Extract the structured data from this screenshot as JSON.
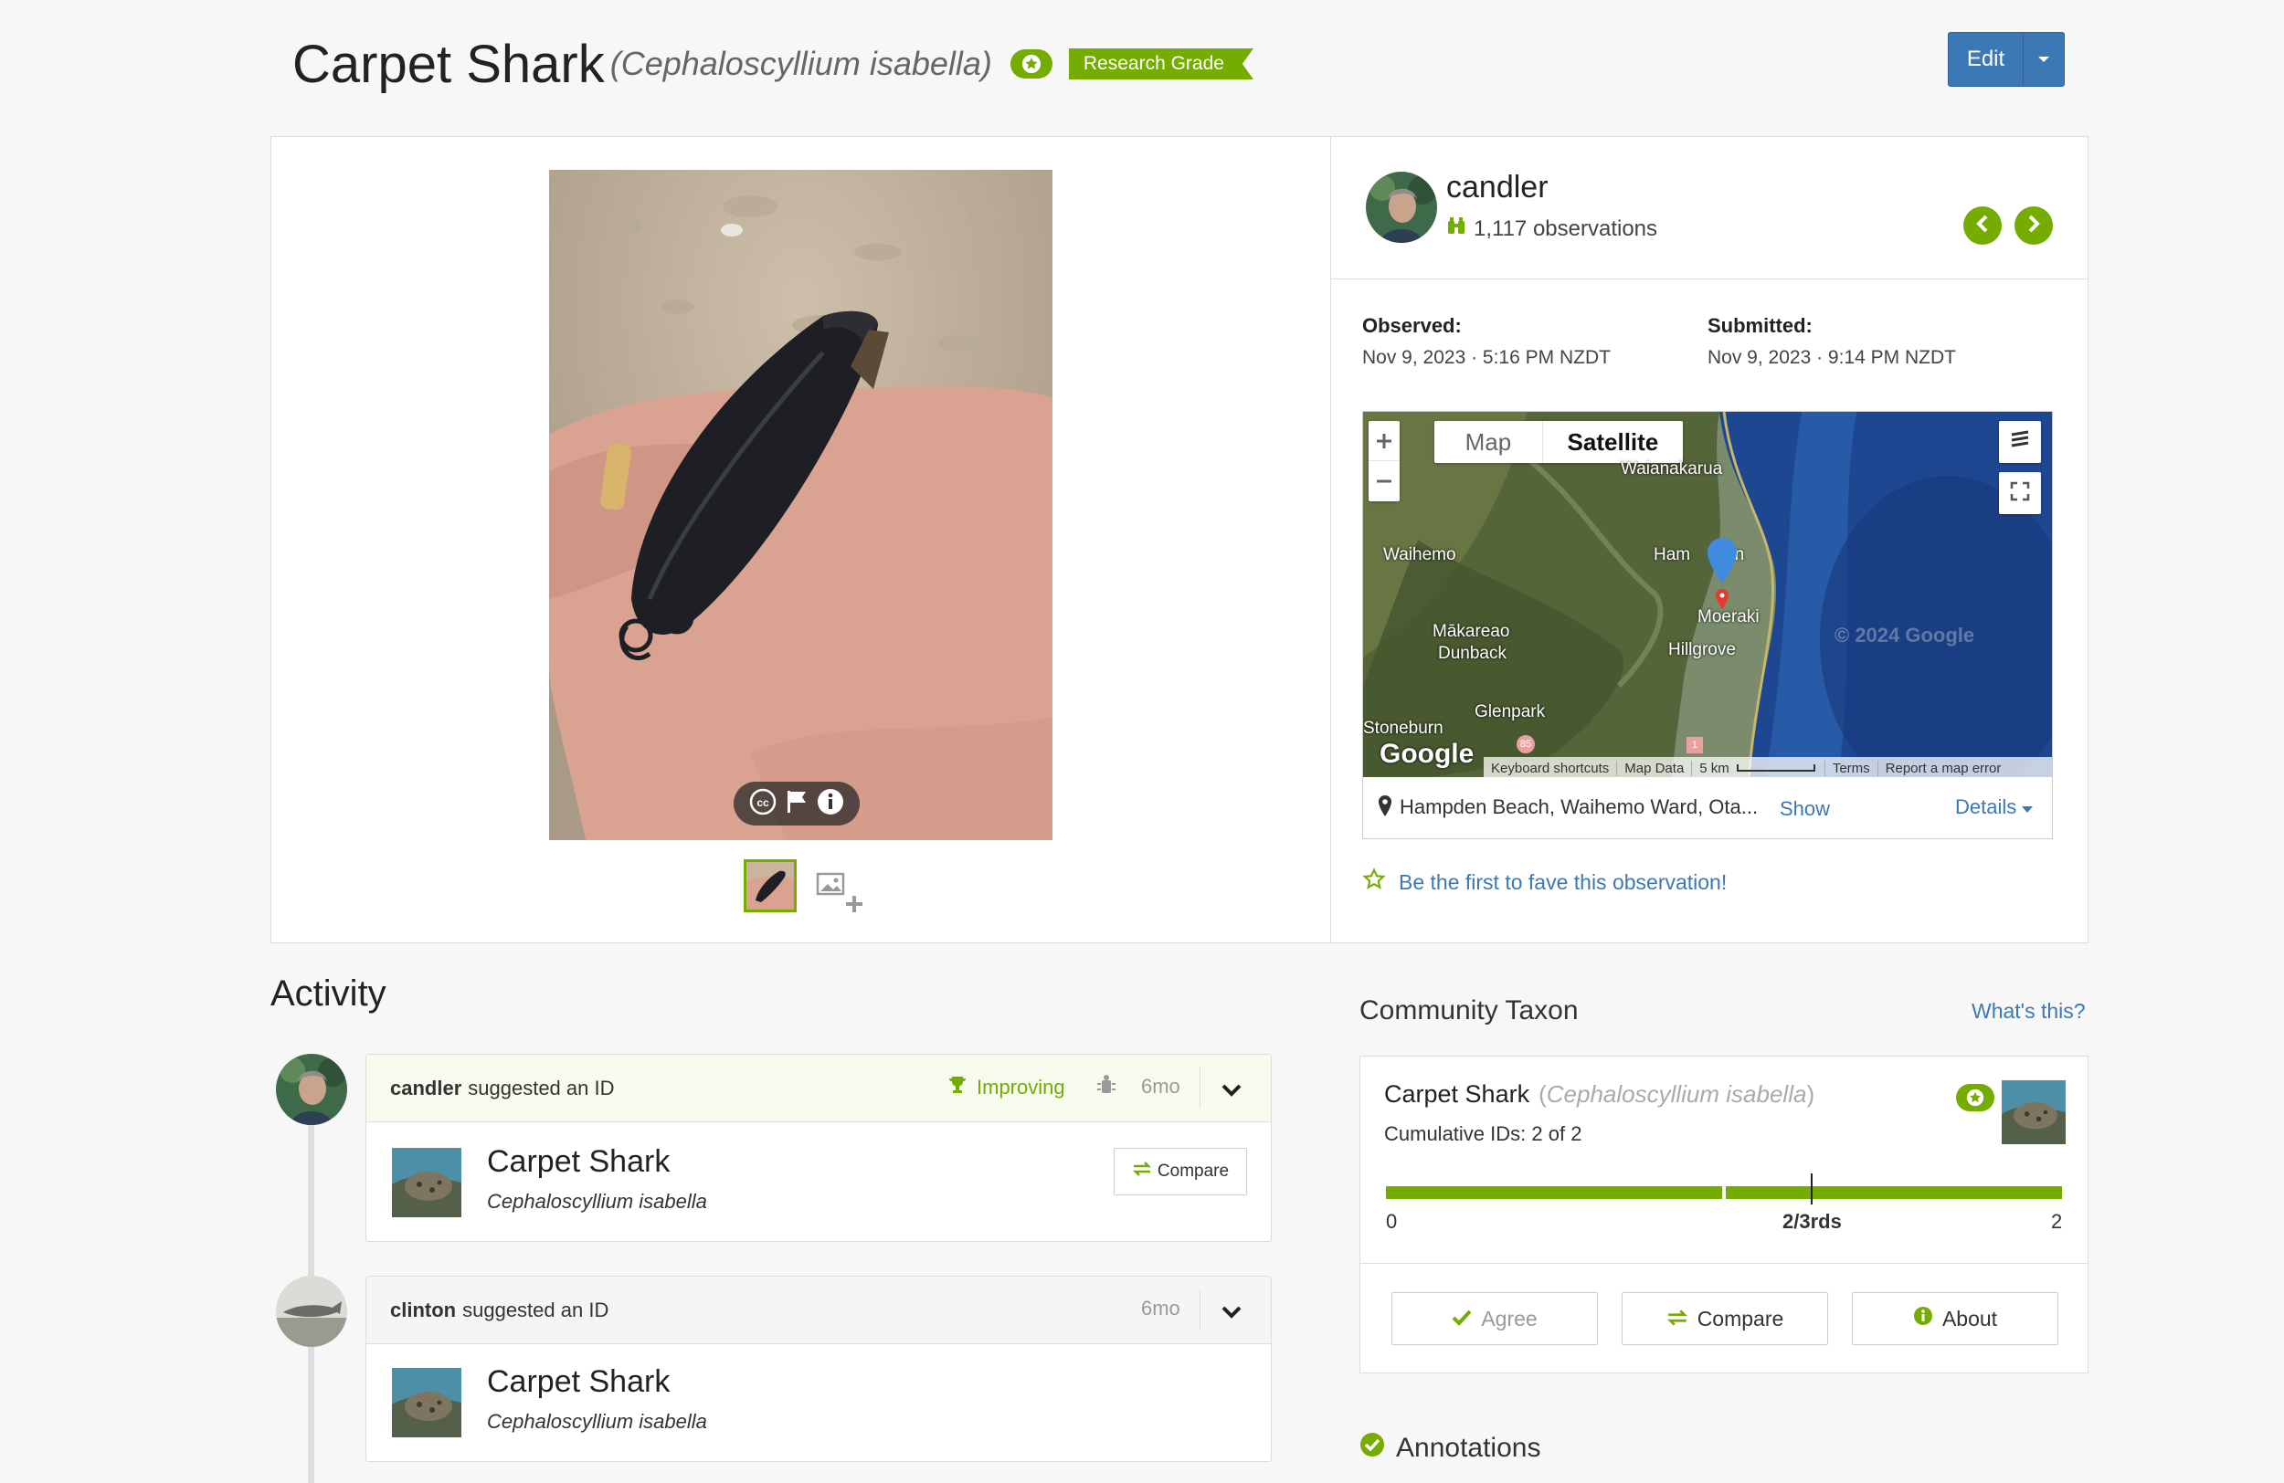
{
  "header": {
    "common_name": "Carpet Shark",
    "scientific_name": "(Cephaloscyllium isabella)",
    "quality_badge": "Research Grade",
    "edit_label": "Edit"
  },
  "observer": {
    "username": "candler",
    "observations": "1,117 observations"
  },
  "dates": {
    "observed_label": "Observed:",
    "observed_value": "Nov 9, 2023 · 5:16 PM NZDT",
    "submitted_label": "Submitted:",
    "submitted_value": "Nov 9, 2023 · 9:14 PM NZDT"
  },
  "map": {
    "tab_map": "Map",
    "tab_satellite": "Satellite",
    "places": [
      "Waianakarua",
      "Waihemo",
      "Ham",
      "en",
      "Moeraki",
      "Mākareao",
      "Dunback",
      "Hillgrove",
      "Glenpark",
      "Stoneburn",
      "Google",
      "85",
      "1"
    ],
    "attribution": [
      "Keyboard shortcuts",
      "Map Data",
      "5 km",
      "Terms",
      "Report a map error"
    ],
    "watermark": "© 2024 Google",
    "location": "Hampden Beach, Waihemo Ward, Ota...",
    "show_label": "Show",
    "details_label": "Details"
  },
  "fave_text": "Be the first to fave this observation!",
  "activity": {
    "title": "Activity",
    "items": [
      {
        "user": "candler",
        "action": "suggested an ID",
        "badge": "Improving",
        "time": "6mo",
        "taxon_common": "Carpet Shark",
        "taxon_sci": "Cephaloscyllium isabella",
        "compare": "Compare"
      },
      {
        "user": "clinton",
        "action": "suggested an ID",
        "time": "6mo",
        "taxon_common": "Carpet Shark",
        "taxon_sci": "Cephaloscyllium isabella"
      }
    ]
  },
  "community": {
    "title": "Community Taxon",
    "whats_this": "What's this?",
    "taxon_common": "Carpet Shark",
    "taxon_sci_open": "(",
    "taxon_sci": "Cephaloscyllium isabella",
    "taxon_sci_close": ")",
    "cumulative": "Cumulative IDs: 2 of 2",
    "bar_min": "0",
    "bar_mid": "2/3rds",
    "bar_max": "2",
    "agreement_fraction": 1.0,
    "agree": "Agree",
    "compare": "Compare",
    "about": "About"
  },
  "annotations_title": "Annotations",
  "colors": {
    "accent_green": "#74ac00",
    "link_blue": "#3c78b5",
    "edit_blue": "#3c78b5"
  }
}
